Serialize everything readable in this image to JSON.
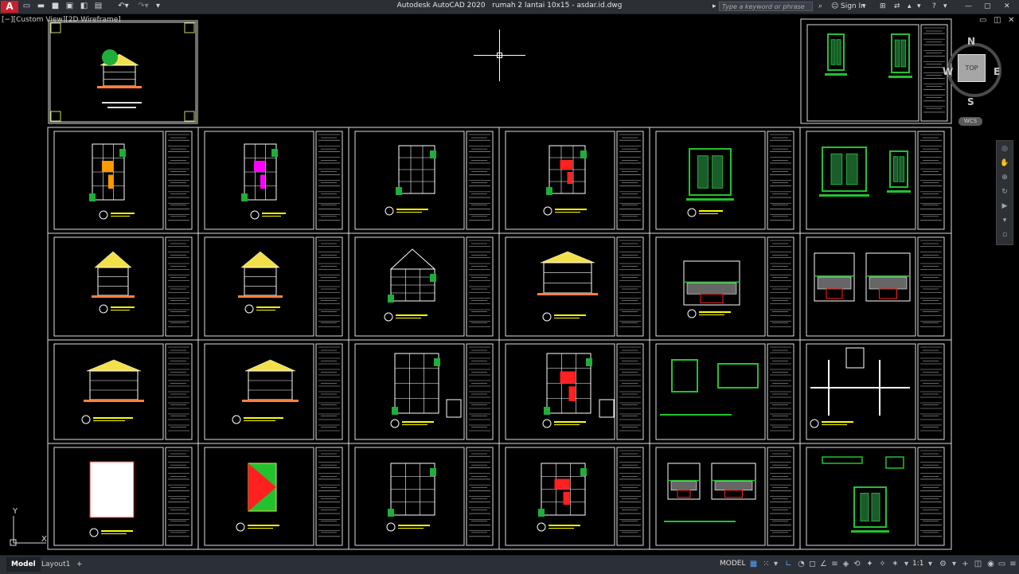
{
  "app": {
    "title": "Autodesk AutoCAD 2020",
    "drawing_name": "rumah 2 lantai 10x15 - asdar.id.dwg",
    "search_placeholder": "Type a keyword or phrase",
    "sign_in": "Sign In",
    "app_button": "A"
  },
  "viewport": {
    "label": "[−][Custom View][2D Wireframe]"
  },
  "viewcube": {
    "north": "N",
    "south": "S",
    "east": "E",
    "west": "W",
    "face": "TOP",
    "wcs": "WCS"
  },
  "ucs": {
    "x": "X",
    "y": "Y"
  },
  "layout_tabs": [
    {
      "label": "Model",
      "active": true
    },
    {
      "label": "Layout1",
      "active": false
    },
    {
      "label": "+",
      "active": false
    }
  ],
  "status": {
    "model": "MODEL",
    "scale": "1:1"
  },
  "icons": {
    "quick_access": [
      "new-icon",
      "open-icon",
      "save-icon",
      "save-as-icon",
      "web-icon",
      "plot-icon",
      "undo-icon",
      "redo-icon",
      "dropdown-icon"
    ],
    "status": [
      "grid-icon",
      "snap-icon",
      "ortho-icon",
      "polar-icon",
      "osnap-icon",
      "otrack-icon",
      "lineweight-icon",
      "transparency-icon",
      "selection-cycling-icon",
      "annotation-icon",
      "workspace-icon",
      "isolate-icon",
      "hardware-accel-icon",
      "clean-screen-icon",
      "customize-icon"
    ]
  },
  "colors": {
    "background": "#000000",
    "frame": "#ffffff",
    "title_block": "#ffffff",
    "roof_yellow": "#f2e04a",
    "plan_magenta": "#ff00ff",
    "plan_red": "#ff2020",
    "detail_green": "#22c22e",
    "label_yellow": "#ffff00",
    "foliage_green": "#1fae3a",
    "dim_cyan": "#00d0d0"
  }
}
